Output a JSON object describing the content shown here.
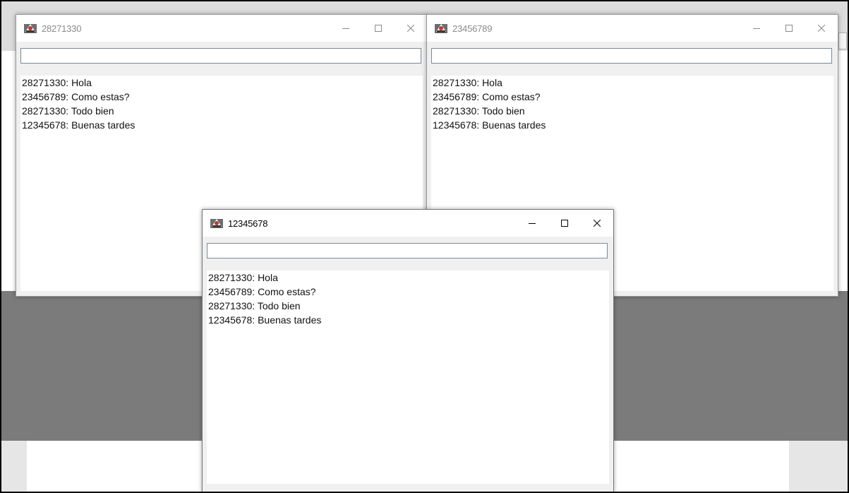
{
  "windows": {
    "w1": {
      "title": "28271330",
      "input_value": "",
      "messages": [
        "28271330: Hola",
        "23456789: Como estas?",
        "28271330: Todo bien",
        "12345678: Buenas tardes"
      ]
    },
    "w2": {
      "title": "23456789",
      "input_value": "",
      "messages": [
        "28271330: Hola",
        "23456789: Como estas?",
        "28271330: Todo bien",
        "12345678: Buenas tardes"
      ]
    },
    "w3": {
      "title": "12345678",
      "input_value": "",
      "messages": [
        "28271330: Hola",
        "23456789: Como estas?",
        "28271330: Todo bien",
        "12345678: Buenas tardes"
      ]
    }
  },
  "icons": {
    "app": "java-app-icon",
    "minimize": "minimize-icon",
    "maximize": "maximize-icon",
    "close": "close-icon"
  }
}
